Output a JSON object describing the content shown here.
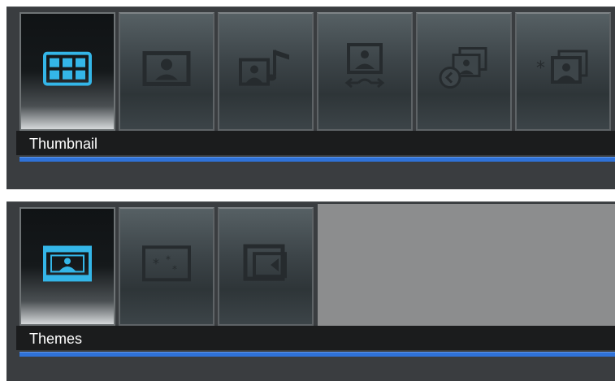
{
  "panels": [
    {
      "label": "Thumbnail",
      "items": [
        {
          "icon": "grid-thumbnail-icon",
          "selected": true
        },
        {
          "icon": "photo-icon",
          "selected": false
        },
        {
          "icon": "photo-music-icon",
          "selected": false
        },
        {
          "icon": "photo-transition-icon",
          "selected": false
        },
        {
          "icon": "slideshow-timer-icon",
          "selected": false
        },
        {
          "icon": "photo-effect-icon",
          "selected": false
        }
      ]
    },
    {
      "label": "Themes",
      "items": [
        {
          "icon": "photo-frame-icon",
          "selected": true
        },
        {
          "icon": "sparkle-theme-icon",
          "selected": false
        },
        {
          "icon": "frame-arrow-icon",
          "selected": false
        }
      ]
    }
  ],
  "colors": {
    "accent_blue": "#2f72d8",
    "icon_selected": "#34b6e8",
    "icon_dim": "#262b2e",
    "panel_bg": "#3a3d40",
    "label_bg": "#1b1c1d"
  }
}
